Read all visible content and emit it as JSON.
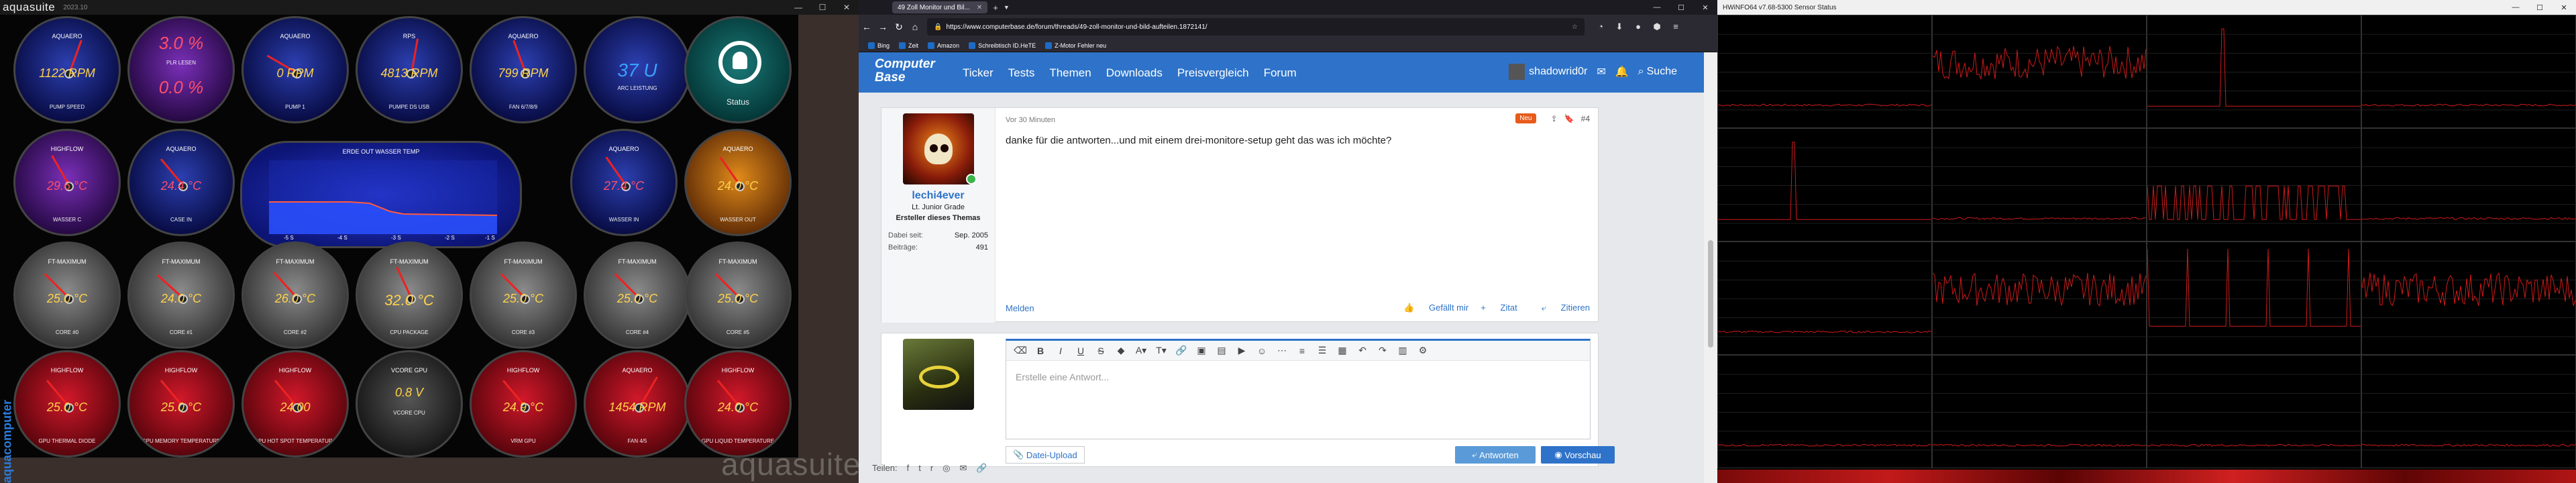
{
  "aquasuite": {
    "app_name": "aquasuite",
    "version": "2023.10",
    "side_brand": "aquacomputer",
    "watermark": "aquasuite",
    "status_label": "Status",
    "pct_top": "3.0 %",
    "pct_bottom": "0.0 %",
    "volt": "37 U",
    "row1": [
      {
        "top": "AQUAERO",
        "value": "1122 RPM",
        "sub": "PUMP SPEED"
      },
      {
        "top": "",
        "value": "3.0 %",
        "sub": "PLR LESEN"
      },
      {
        "top": "AQUAERO",
        "value": "0 RPM",
        "sub": "PUMP 1"
      },
      {
        "top": "RPS",
        "value": "4813 RPM",
        "sub": "PUMPE DS USB"
      },
      {
        "top": "AQUAERO",
        "value": "799 RPM",
        "sub": "FAN 6/7/8/9"
      },
      {
        "top": "",
        "value": "37 U",
        "sub": "ARC LEISTUNG"
      }
    ],
    "row2": [
      {
        "top": "HIGHFLOW",
        "value": "29.6 °C",
        "sub": "WASSER C"
      },
      {
        "top": "AQUAERO",
        "value": "24.4 °C",
        "sub": "CASE IN"
      },
      {
        "top": "AQUAERO",
        "value": "27.4 °C",
        "sub": "WASSER IN"
      },
      {
        "top": "AQUAERO",
        "value": "24.0 °C",
        "sub": "WASSER OUT"
      }
    ],
    "row3": [
      {
        "top": "FT-MAXIMUM",
        "value": "25.0 °C",
        "sub": "CORE #0"
      },
      {
        "top": "FT-MAXIMUM",
        "value": "24.0 °C",
        "sub": "CORE #1"
      },
      {
        "top": "FT-MAXIMUM",
        "value": "26.0 °C",
        "sub": "CORE #2"
      },
      {
        "top": "FT-MAXIMUM",
        "value": "32.0 °C",
        "sub": "CPU PACKAGE"
      },
      {
        "top": "FT-MAXIMUM",
        "value": "25.0 °C",
        "sub": "CORE #3"
      },
      {
        "top": "FT-MAXIMUM",
        "value": "25.0 °C",
        "sub": "CORE #4"
      },
      {
        "top": "FT-MAXIMUM",
        "value": "25.0 °C",
        "sub": "CORE #5"
      }
    ],
    "row4": [
      {
        "top": "HIGHFLOW",
        "value": "25.0 °C",
        "sub": "GPU THERMAL DIODE"
      },
      {
        "top": "HIGHFLOW",
        "value": "25.0 °C",
        "sub": "GPU MEMORY TEMPERATURE"
      },
      {
        "top": "HIGHFLOW",
        "value": "24.00",
        "sub": "GPU HOT SPOT TEMPERATURE"
      },
      {
        "top": "VCORE GPU",
        "value": "0.8 V",
        "sub": "VCORE CPU"
      },
      {
        "top": "HIGHFLOW",
        "value": "24.9 °C",
        "sub": "VRM GPU"
      },
      {
        "top": "AQUAERO",
        "value": "1454 RPM",
        "sub": "FAN 4/5"
      },
      {
        "top": "HIGHFLOW",
        "value": "24.0 °C",
        "sub": "GPU LIQUID TEMPERATURE"
      }
    ],
    "chart": {
      "title": "ERDE OUT WASSER TEMP",
      "x_labels": [
        "-5 S",
        "-4 S",
        "-3 S",
        "-2 S",
        "-1 S"
      ]
    },
    "colors": {
      "accent": "#2a7de1",
      "value": "#ffd24a",
      "needle": "#e22222"
    }
  },
  "firefox": {
    "tab_title": "49 Zoll Monitor und Bil...",
    "url": "https://www.computerbase.de/forum/threads/49-zoll-monitor-und-bild-aufteilen.1872141/",
    "bookmarks": [
      "Bing",
      "Zeit",
      "Amazon",
      "Schreibtisch ID.HeTE",
      "Z-Motor Fehler neu"
    ],
    "site": {
      "logo_line1": "Computer",
      "logo_line2": "Base",
      "nav": [
        "Ticker",
        "Tests",
        "Themen",
        "Downloads",
        "Preisvergleich",
        "Forum"
      ],
      "username": "shadowrid0r",
      "search": "Suche"
    },
    "post": {
      "meta": "Vor 30 Minuten",
      "badge": "Neu",
      "number": "#4",
      "text": "danke für die antworten...und mit einem drei-monitore-setup geht das was ich möchte?",
      "author": "lechi4ever",
      "rank": "Lt. Junior Grade",
      "starter": "Ersteller dieses Themas",
      "joined_label": "Dabei seit:",
      "joined_value": "Sep. 2005",
      "posts_label": "Beiträge:",
      "posts_value": "491",
      "report": "Melden",
      "like": "Gefällt mir",
      "quote": "Zitat",
      "cite": "Zitieren"
    },
    "reply": {
      "placeholder": "Erstelle eine Antwort...",
      "upload": "Datei-Upload",
      "answer": "Antworten",
      "preview": "Vorschau"
    },
    "share_label": "Teilen:",
    "colors": {
      "brand": "#2e73c9",
      "badge": "#e85a1a"
    }
  },
  "hwinfo": {
    "title": "HWiNFO64 v7.68-5300 Sensor Status",
    "graph_color": "#d01a1a"
  }
}
